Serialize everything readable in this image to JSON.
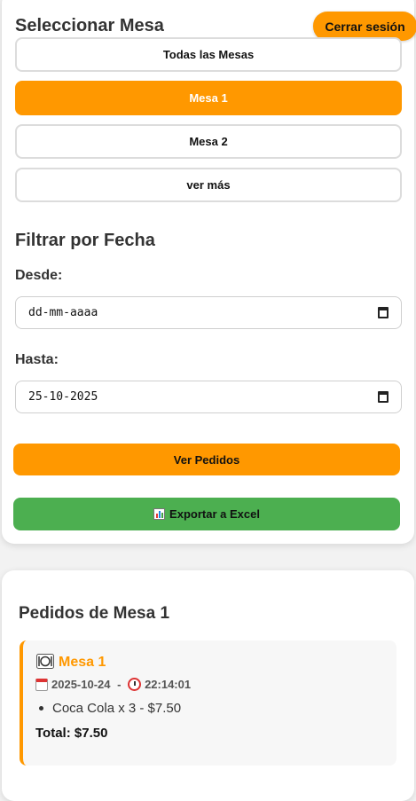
{
  "header": {
    "title": "Seleccionar Mesa",
    "logout_label": "Cerrar sesión"
  },
  "mesas": {
    "all_label": "Todas las Mesas",
    "items": [
      "Mesa 1",
      "Mesa 2"
    ],
    "selected": "Mesa 1",
    "more_label": "ver más"
  },
  "filter": {
    "title": "Filtrar por Fecha",
    "from_label": "Desde:",
    "from_value": "dd-mm-aaaa",
    "to_label": "Hasta:",
    "to_value": "25-10-2025",
    "view_label": "Ver Pedidos",
    "export_label": "Exportar a Excel",
    "export_icon": "bar-chart-icon"
  },
  "orders": {
    "title": "Pedidos de Mesa 1",
    "items": [
      {
        "mesa": "Mesa 1",
        "date": "2025-10-24",
        "separator": " - ",
        "time": "22:14:01",
        "lines": [
          "Coca Cola x 3 - $7.50"
        ],
        "total": "Total: $7.50"
      }
    ]
  },
  "colors": {
    "accent": "#ff9800",
    "success": "#4caf50",
    "background": "#f2f2f2"
  }
}
